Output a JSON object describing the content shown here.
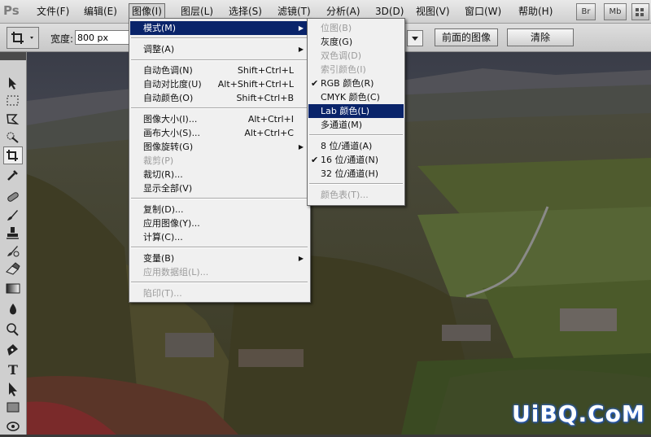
{
  "app": {
    "logo": "Ps"
  },
  "menubar": {
    "items": [
      "文件(F)",
      "编辑(E)",
      "图像(I)",
      "图层(L)",
      "选择(S)",
      "滤镜(T)",
      "分析(A)",
      "3D(D)",
      "视图(V)",
      "窗口(W)",
      "帮助(H)"
    ],
    "active": "图像(I)",
    "bridge_btn": "Br",
    "minibridge_btn": "Mb"
  },
  "options_bar": {
    "width_label": "宽度:",
    "width_value": "800 px",
    "front_image_label": "前面的图像",
    "clear_label": "清除"
  },
  "image_menu": {
    "items": [
      {
        "label": "模式(M)",
        "shortcut": "",
        "submenu": true,
        "state": "highlighted"
      },
      {
        "label": "调整(A)",
        "shortcut": "",
        "submenu": true,
        "state": "normal"
      },
      {
        "label": "自动色调(N)",
        "shortcut": "Shift+Ctrl+L",
        "state": "normal"
      },
      {
        "label": "自动对比度(U)",
        "shortcut": "Alt+Shift+Ctrl+L",
        "state": "normal"
      },
      {
        "label": "自动颜色(O)",
        "shortcut": "Shift+Ctrl+B",
        "state": "normal"
      },
      {
        "label": "图像大小(I)...",
        "shortcut": "Alt+Ctrl+I",
        "state": "normal"
      },
      {
        "label": "画布大小(S)...",
        "shortcut": "Alt+Ctrl+C",
        "state": "normal"
      },
      {
        "label": "图像旋转(G)",
        "shortcut": "",
        "submenu": true,
        "state": "normal"
      },
      {
        "label": "裁剪(P)",
        "shortcut": "",
        "state": "disabled"
      },
      {
        "label": "裁切(R)...",
        "shortcut": "",
        "state": "normal"
      },
      {
        "label": "显示全部(V)",
        "shortcut": "",
        "state": "normal"
      },
      {
        "label": "复制(D)...",
        "shortcut": "",
        "state": "normal"
      },
      {
        "label": "应用图像(Y)...",
        "shortcut": "",
        "state": "normal"
      },
      {
        "label": "计算(C)...",
        "shortcut": "",
        "state": "normal"
      },
      {
        "label": "变量(B)",
        "shortcut": "",
        "submenu": true,
        "state": "normal"
      },
      {
        "label": "应用数据组(L)...",
        "shortcut": "",
        "state": "disabled"
      },
      {
        "label": "陷印(T)...",
        "shortcut": "",
        "state": "disabled"
      }
    ]
  },
  "mode_menu": {
    "items": [
      {
        "label": "位图(B)",
        "state": "disabled",
        "checked": false
      },
      {
        "label": "灰度(G)",
        "state": "normal",
        "checked": false
      },
      {
        "label": "双色调(D)",
        "state": "disabled",
        "checked": false
      },
      {
        "label": "索引颜色(I)",
        "state": "disabled",
        "checked": false
      },
      {
        "label": "RGB 颜色(R)",
        "state": "normal",
        "checked": true
      },
      {
        "label": "CMYK 颜色(C)",
        "state": "normal",
        "checked": false
      },
      {
        "label": "Lab 颜色(L)",
        "state": "highlighted",
        "checked": false
      },
      {
        "label": "多通道(M)",
        "state": "normal",
        "checked": false
      },
      {
        "label": "8 位/通道(A)",
        "state": "normal",
        "checked": false
      },
      {
        "label": "16 位/通道(N)",
        "state": "normal",
        "checked": true
      },
      {
        "label": "32 位/通道(H)",
        "state": "normal",
        "checked": false
      },
      {
        "label": "颜色表(T)...",
        "state": "disabled",
        "checked": false
      }
    ]
  },
  "watermark": "UiBQ.CoM",
  "colors": {
    "menu_highlight": "#0a246a",
    "menu_bg": "#f0f0f0",
    "disabled_text": "#9b9b9b"
  }
}
